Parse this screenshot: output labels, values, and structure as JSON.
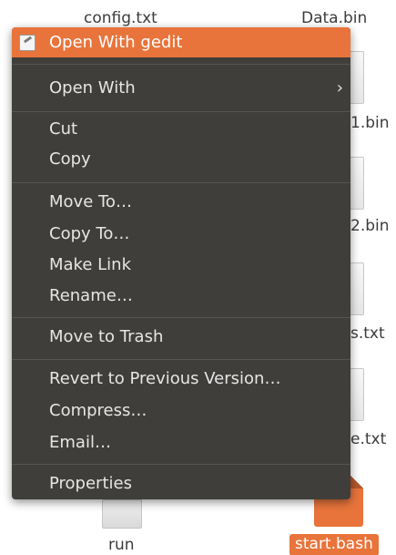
{
  "desktop": {
    "top_labels": {
      "config": "config.txt",
      "data": "Data.bin"
    },
    "side_labels": {
      "file1": "1.bin",
      "file2": "2.bin",
      "file3": "s.txt",
      "file4": "e.txt"
    },
    "bottom": {
      "run_label": "run",
      "bash_label": "start.bash"
    }
  },
  "context_menu": {
    "open_with_gedit": "Open With gedit",
    "open_with": "Open With",
    "submenu_arrow": "›",
    "cut": "Cut",
    "copy": "Copy",
    "move_to": "Move To…",
    "copy_to": "Copy To…",
    "make_link": "Make Link",
    "rename": "Rename…",
    "move_to_trash": "Move to Trash",
    "revert": "Revert to Previous Version…",
    "compress": "Compress…",
    "email": "Email…",
    "properties": "Properties"
  },
  "colors": {
    "accent": "#e8743b",
    "menu_background": "#3f3e3a",
    "menu_text": "#e6e6e6"
  }
}
